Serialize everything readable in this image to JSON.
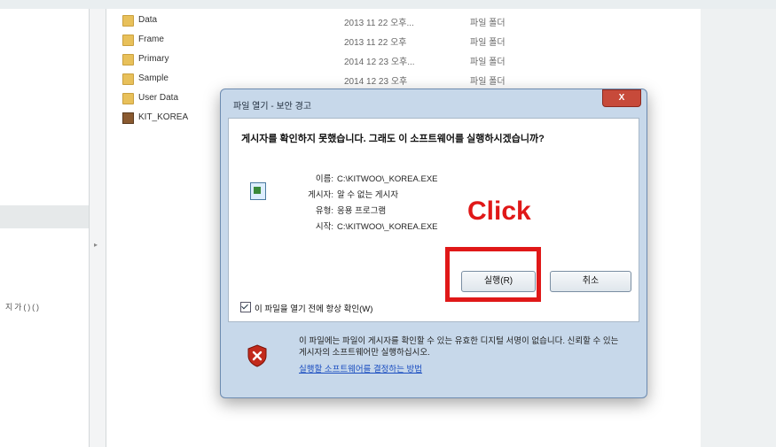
{
  "sidebar": {
    "text": "지 가 ( ) ( )"
  },
  "files": [
    {
      "name": "Data",
      "date": "2013 11 22 오후...",
      "type": "파일 폴더",
      "icon": "folder-icon"
    },
    {
      "name": "Frame",
      "date": "2013 11 22 오후",
      "type": "파일 폴더",
      "icon": "folder-icon"
    },
    {
      "name": "Primary",
      "date": "2014 12 23 오후...",
      "type": "파일 폴더",
      "icon": "folder-icon"
    },
    {
      "name": "Sample",
      "date": "2014 12 23 오후",
      "type": "파일 폴더",
      "icon": "folder-icon"
    },
    {
      "name": "User Data",
      "date": "2014 12 23 오후",
      "type": "파일 폴더",
      "icon": "folder-icon"
    },
    {
      "name": "KIT_KOREA",
      "date": "",
      "type": "",
      "icon": "app-icon"
    }
  ],
  "dialog": {
    "title": "파일 열기 - 보안 경고",
    "close_label": "X",
    "headline": "게시자를 확인하지 못했습니다. 그래도 이 소프트웨어를 실행하시겠습니까?",
    "info": [
      {
        "label": "이름:",
        "value": "C:\\KITWOO\\_KOREA.EXE"
      },
      {
        "label": "게시자:",
        "value": "알 수 없는 게시자"
      },
      {
        "label": "유형:",
        "value": "응용 프로그램"
      },
      {
        "label": "시작:",
        "value": "C:\\KITWOO\\_KOREA.EXE"
      }
    ],
    "run_label": "실행(R)",
    "cancel_label": "취소",
    "checkbox_label": "이 파일을 열기 전에 항상 확인(W)",
    "warning_text": "이 파일에는 파일이 게시자를 확인할 수 있는 유효한 디지털 서명이 없습니다. 신뢰할 수 있는 게시자의 소프트웨어만 실행하십시오.",
    "warning_link": "실행할 소프트웨어를 결정하는 방법"
  },
  "annotation": {
    "label": "Click",
    "color": "#e01818"
  }
}
